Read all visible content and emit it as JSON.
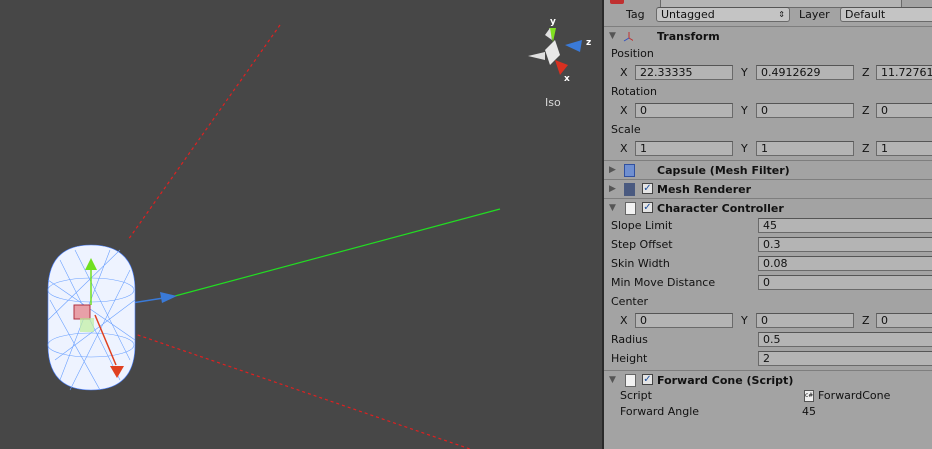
{
  "scene": {
    "view_label": "Iso",
    "gizmo_axes": {
      "y": "y",
      "z": "z",
      "x": "x"
    }
  },
  "header": {
    "tag_label": "Tag",
    "tag_value": "Untagged",
    "layer_label": "Layer",
    "layer_value": "Default"
  },
  "transform": {
    "title": "Transform",
    "position": {
      "label": "Position",
      "x": "22.33335",
      "y": "0.4912629",
      "z": "11.72761"
    },
    "rotation": {
      "label": "Rotation",
      "x": "0",
      "y": "0",
      "z": "0"
    },
    "scale": {
      "label": "Scale",
      "x": "1",
      "y": "1",
      "z": "1"
    }
  },
  "axis_labels": {
    "x": "X",
    "y": "Y",
    "z": "Z"
  },
  "mesh_filter": {
    "title": "Capsule (Mesh Filter)"
  },
  "mesh_renderer": {
    "title": "Mesh Renderer",
    "enabled": true
  },
  "character_controller": {
    "title": "Character Controller",
    "enabled": true,
    "slope_limit": {
      "label": "Slope Limit",
      "value": "45"
    },
    "step_offset": {
      "label": "Step Offset",
      "value": "0.3"
    },
    "skin_width": {
      "label": "Skin Width",
      "value": "0.08"
    },
    "min_move": {
      "label": "Min Move Distance",
      "value": "0"
    },
    "center": {
      "label": "Center",
      "x": "0",
      "y": "0",
      "z": "0"
    },
    "radius": {
      "label": "Radius",
      "value": "0.5"
    },
    "height": {
      "label": "Height",
      "value": "2"
    }
  },
  "forward_cone": {
    "title": "Forward Cone (Script)",
    "enabled": true,
    "script": {
      "label": "Script",
      "value": "ForwardCone"
    },
    "forward_angle": {
      "label": "Forward Angle",
      "value": "45"
    }
  }
}
